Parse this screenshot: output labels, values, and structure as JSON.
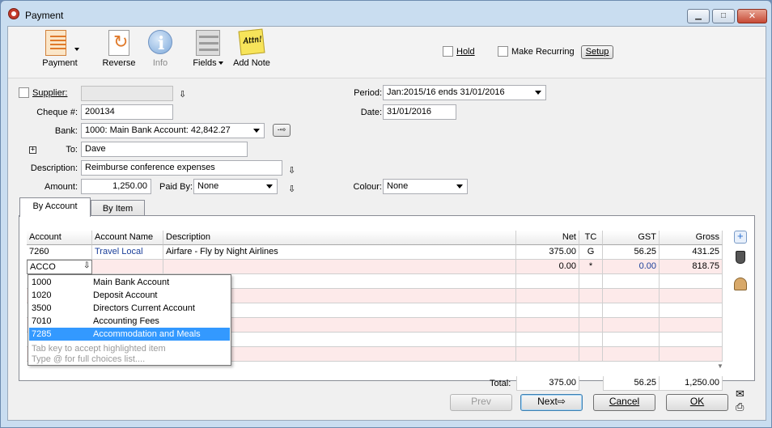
{
  "window": {
    "title": "Payment",
    "min_label": "▁",
    "max_label": "□",
    "close_label": "✕"
  },
  "toolbar": {
    "payment": "Payment",
    "reverse": "Reverse",
    "info": "Info",
    "fields": "Fields",
    "add_note": "Add Note",
    "add_note_icon_text": "Attn!",
    "hold": "Hold",
    "make_recurring": "Make Recurring",
    "setup": "Setup"
  },
  "form": {
    "supplier_label": "Supplier:",
    "supplier_value": "",
    "cheque_label": "Cheque #:",
    "cheque_value": "200134",
    "bank_label": "Bank:",
    "bank_value": "1000: Main Bank Account: 42,842.27",
    "to_label": "To:",
    "to_value": "Dave",
    "description_label": "Description:",
    "description_value": "Reimburse conference expenses",
    "amount_label": "Amount:",
    "amount_value": "1,250.00",
    "paid_by_label": "Paid By:",
    "paid_by_value": "None",
    "period_label": "Period:",
    "period_value": "Jan:2015/16 ends 31/01/2016",
    "date_label": "Date:",
    "date_value": "31/01/2016",
    "colour_label": "Colour:",
    "colour_value": "None"
  },
  "tabs": [
    {
      "label": "By Account"
    },
    {
      "label": "By Item"
    }
  ],
  "grid": {
    "columns": [
      "Account",
      "Account Name",
      "Description",
      "Net",
      "TC",
      "GST",
      "Gross"
    ],
    "rows": [
      {
        "account": "7260",
        "account_name": "Travel Local",
        "description": "Airfare - Fly by Night Airlines",
        "net": "375.00",
        "tc": "G",
        "gst": "56.25",
        "gross": "431.25"
      },
      {
        "account": "ACCO",
        "account_name": "",
        "description": "",
        "net": "0.00",
        "tc": "*",
        "gst": "0.00",
        "gross": "818.75"
      }
    ],
    "totals": {
      "label": "Total:",
      "net": "375.00",
      "gst": "56.25",
      "gross": "1,250.00"
    }
  },
  "dropdown": {
    "items": [
      {
        "code": "1000",
        "name": "Main Bank Account"
      },
      {
        "code": "1020",
        "name": "Deposit Account"
      },
      {
        "code": "3500",
        "name": "Directors Current Account"
      },
      {
        "code": "7010",
        "name": "Accounting Fees"
      },
      {
        "code": "7285",
        "name": "Accommodation and Meals"
      }
    ],
    "hint1": "Tab key to accept highlighted item",
    "hint2": "Type @ for full choices list...."
  },
  "footer": {
    "prev": "Prev",
    "next": "Next",
    "cancel": "Cancel",
    "ok": "OK"
  },
  "colors": {
    "selected": "#3399ff",
    "row_pink": "#fdeaea",
    "link_blue": "#1a3f9a"
  }
}
